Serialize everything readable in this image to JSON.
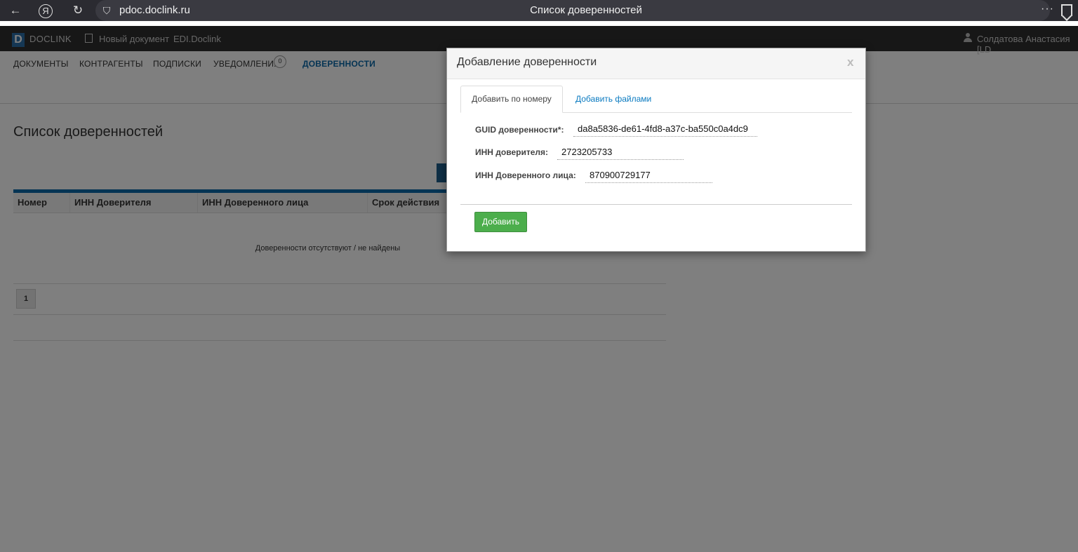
{
  "browser": {
    "url": "pdoc.doclink.ru",
    "tab_title": "Список доверенностей",
    "menu_dots": "···"
  },
  "header": {
    "logo_letter": "D",
    "logo_text": "DOCLINK",
    "new_document": "Новый документ",
    "edi": "EDI.Doclink",
    "user": "Солдатова Анастасия [LD"
  },
  "nav": {
    "items": [
      "ДОКУМЕНТЫ",
      "КОНТРАГЕНТЫ",
      "ПОДПИСКИ",
      "УВЕДОМЛЕНИЯ",
      "ДОВЕРЕННОСТИ"
    ],
    "notifications_count": "0"
  },
  "page": {
    "title": "Список доверенностей",
    "columns": [
      "Номер",
      "ИНН Доверителя",
      "ИНН Доверенного лица",
      "Срок действия"
    ],
    "empty_message": "Доверенности отсутствуют / не найдены",
    "page_number": "1"
  },
  "modal": {
    "title": "Добавление доверенности",
    "close": "x",
    "tabs": [
      "Добавить по номеру",
      "Добавить файлами"
    ],
    "fields": [
      {
        "label": "GUID доверенности*:",
        "value": "da8a5836-de61-4fd8-a37c-ba550c0a4dc9"
      },
      {
        "label": "ИНН доверителя:",
        "value": "2723205733"
      },
      {
        "label": "ИНН Доверенного лица:",
        "value": "870900729177"
      }
    ],
    "submit": "Добавить"
  }
}
